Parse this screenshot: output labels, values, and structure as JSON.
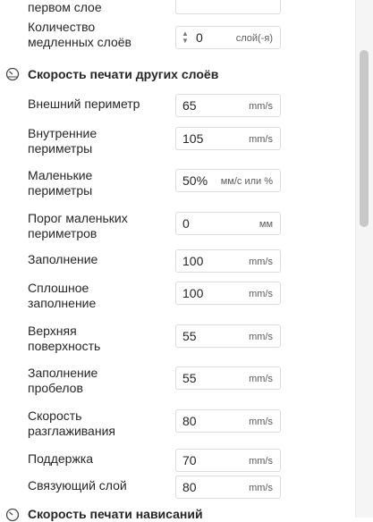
{
  "top_partial": {
    "label": "первом слое"
  },
  "slow_layers": {
    "label_line1": "Количество",
    "label_line2": "медленных слоёв",
    "value": "0",
    "unit": "слой(-я)"
  },
  "section_other": {
    "title": "Скорость печати других слоёв",
    "icon": "speedometer-icon"
  },
  "fields": [
    {
      "label1": "Внешний периметр",
      "label2": "",
      "value": "65",
      "unit": "mm/s"
    },
    {
      "label1": "Внутренние",
      "label2": "периметры",
      "value": "105",
      "unit": "mm/s"
    },
    {
      "label1": "Маленькие",
      "label2": "периметры",
      "value": "50%",
      "unit": "мм/с или %"
    },
    {
      "label1": "Порог маленьких",
      "label2": "периметров",
      "value": "0",
      "unit": "мм"
    },
    {
      "label1": "Заполнение",
      "label2": "",
      "value": "100",
      "unit": "mm/s"
    },
    {
      "label1": "Сплошное",
      "label2": "заполнение",
      "value": "100",
      "unit": "mm/s"
    },
    {
      "label1": "Верхняя",
      "label2": "поверхность",
      "value": "55",
      "unit": "mm/s"
    },
    {
      "label1": "Заполнение",
      "label2": "пробелов",
      "value": "55",
      "unit": "mm/s"
    },
    {
      "label1": "Скорость",
      "label2": "разглаживания",
      "value": "80",
      "unit": "mm/s"
    },
    {
      "label1": "Поддержка",
      "label2": "",
      "value": "70",
      "unit": "mm/s"
    },
    {
      "label1": "Связующий слой",
      "label2": "",
      "value": "80",
      "unit": "mm/s"
    }
  ],
  "section_overhang": {
    "title": "Скорость печати нависаний",
    "icon": "speedometer-icon"
  }
}
